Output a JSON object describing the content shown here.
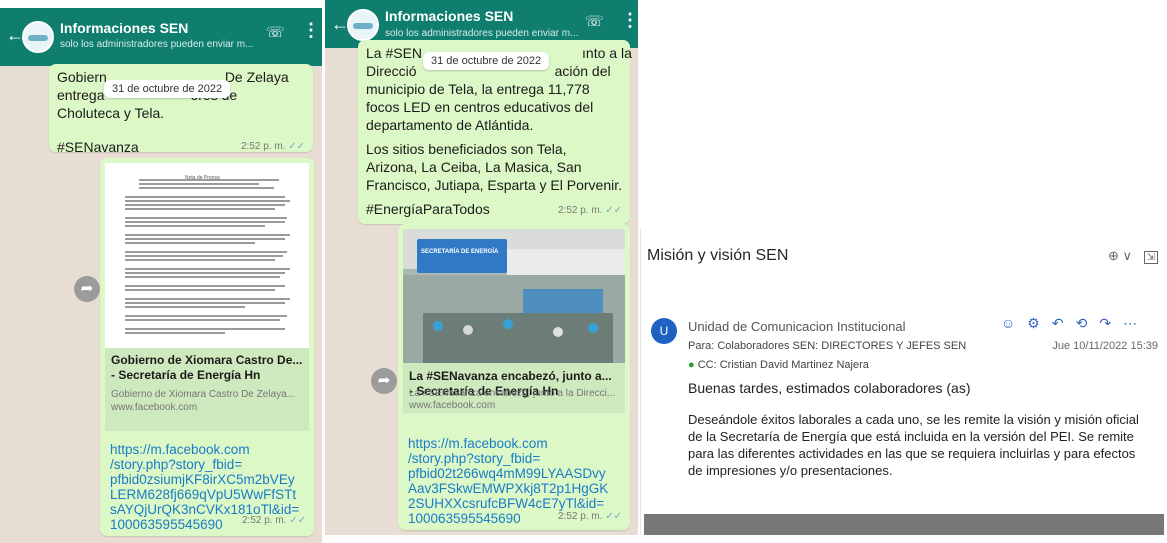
{
  "phone_left": {
    "header": {
      "title": "Informaciones SEN",
      "subtitle": "solo los administradores pueden enviar m..."
    },
    "date_pill": "31 de octubre de 2022",
    "message1": {
      "line1": "Gobiern",
      "line1_tail": "De Zelaya",
      "line2": "entrega",
      "line2_tail": "ores de",
      "line3": "Choluteca y Tela.",
      "hashtag": "#SENavanza",
      "time": "2:52 p. m."
    },
    "preview": {
      "doc_title": "Nota de Prensa",
      "title": "Gobierno de Xiomara Castro De... - Secretaría de Energía Hn",
      "description": "Gobierno de Xiomara Castro De Zelaya...",
      "url": "www.facebook.com"
    },
    "link_text": "https://m.facebook.com/story.php?story_fbid=pfbid0zsiumjKF8irXC5m2bVEyLERM628fj669qVpU5WwFfSTtsAYQjUrQK3nCVKx181oTl&id=100063595545690",
    "link_lines": [
      "https://m.facebook.com",
      "/story.php?story_fbid=",
      "pfbid0zsiumjKF8irXC5m2bVEy",
      "LERM628fj669qVpU5WwFfSTt",
      "sAYQjUrQK3nCVKx181oTl&id=",
      "100063595545690"
    ],
    "link_time": "2:52 p. m."
  },
  "phone_right": {
    "header": {
      "title": "Informaciones SEN",
      "subtitle": "solo los administradores pueden enviar m..."
    },
    "date_pill": "31 de octubre de 2022",
    "message1": {
      "line1": "La #SEN",
      "line1_tail": "ınto a la",
      "line2": "Direcció",
      "line2_tail": "ación del",
      "lines": [
        "municipio de Tela, la entrega 11,778",
        "focos LED en centros educativos del",
        "departamento de Atlántida."
      ],
      "para2": [
        "Los sitios beneficiados son Tela,",
        "Arizona, La Ceiba, La Masica, San",
        "Francisco, Jutiapa, Esparta y El Porvenir."
      ],
      "hashtag": "#EnergíaParaTodos",
      "time": "2:52 p. m."
    },
    "preview": {
      "banner": "SECRETARÍA DE ENERGÍA",
      "title": "La #SENavanza encabezó, junto a... - Secretaría de Energía Hn",
      "description": "La #SENavanza encabezó, junto a la Direcci...",
      "url": "www.facebook.com"
    },
    "link_lines": [
      "https://m.facebook.com",
      "/story.php?story_fbid=",
      "pfbid02t266wq4mM99LYAASDvy",
      "Aav3FSkwEMWPXkj8T2p1HgGK",
      "2SUHXXcsrufcBFW4cE7yTl&id=",
      "100063595545690"
    ],
    "link_time": "2:52 p. m."
  },
  "email": {
    "subject": "Misión y visión SEN",
    "zoom_label": "⊕ ∨",
    "avatar_initial": "U",
    "sender": "Unidad de Comunicacion Institucional",
    "to": "Para: Colaboradores SEN: DIRECTORES Y JEFES SEN",
    "date": "Jue 10/11/2022 15:39",
    "cc": "CC: Cristian David Martinez Najera",
    "greeting": "Buenas tardes, estimados colaboradores (as)",
    "body": "Deseándole éxitos laborales a cada uno, se les remite la visión y misión oficial de la Secretaría de Energía que está incluida en la versión del PEI. Se remite para las diferentes actividades en las que se requiera incluirlas y para efectos de impresiones y/o presentaciones.",
    "accent": "#1e63c1"
  },
  "colors": {
    "wa_header": "#0f7e6e",
    "bubble": "#dcf8c6",
    "chat_bg": "#e7ddd2",
    "link": "#1a7bc9"
  }
}
